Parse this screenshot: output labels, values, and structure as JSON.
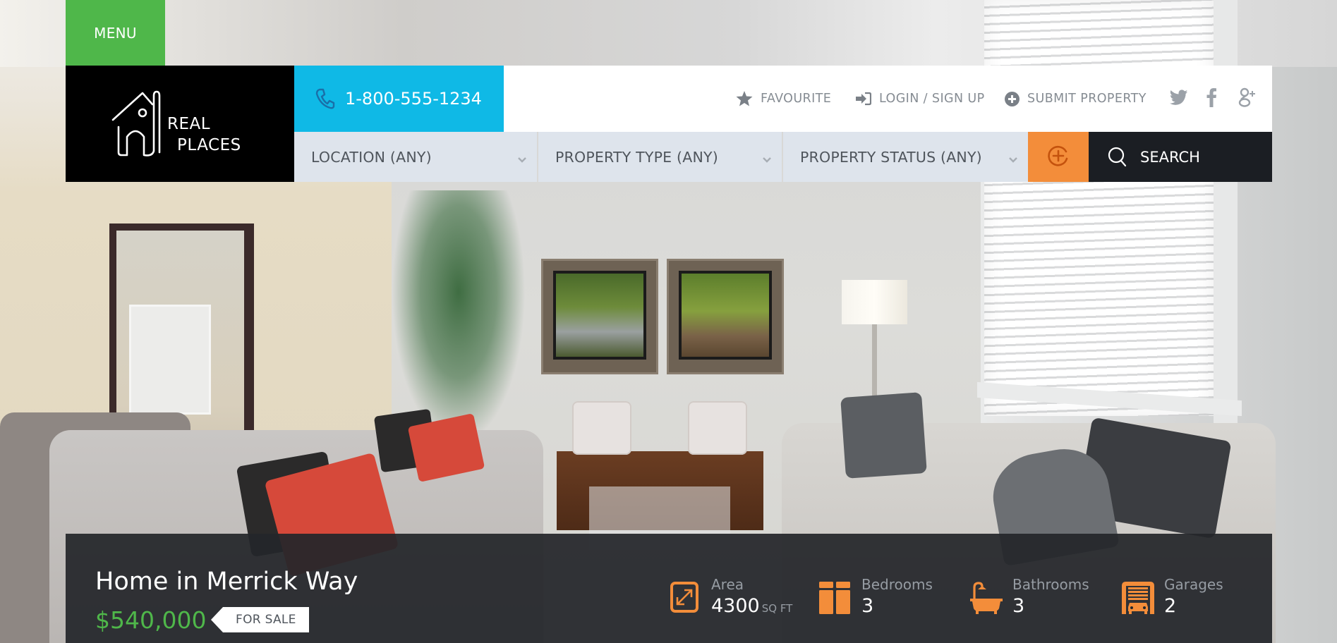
{
  "header": {
    "menu_label": "MENU",
    "logo": {
      "line1": "REAL",
      "line2": "PLACES",
      "icon": "house-logo-icon"
    },
    "phone": {
      "number": "1-800-555-1234",
      "icon": "phone-icon"
    },
    "links": [
      {
        "label": "FAVOURITE",
        "icon": "star-icon"
      },
      {
        "label": "LOGIN / SIGN UP",
        "icon": "sign-in-icon"
      },
      {
        "label": "SUBMIT PROPERTY",
        "icon": "plus-circle-icon"
      }
    ],
    "social": [
      {
        "name": "twitter",
        "icon": "twitter-icon"
      },
      {
        "name": "facebook",
        "icon": "facebook-icon"
      },
      {
        "name": "google-plus",
        "icon": "google-plus-icon"
      }
    ]
  },
  "search": {
    "location": "LOCATION (ANY)",
    "property_type": "PROPERTY TYPE (ANY)",
    "property_status": "PROPERTY STATUS (ANY)",
    "advanced_icon": "plus-circle-icon",
    "button_label": "SEARCH"
  },
  "property": {
    "title": "Home in Merrick Way",
    "price": "$540,000",
    "status": "FOR SALE",
    "stats": {
      "area": {
        "label": "Area",
        "value": "4300",
        "unit": "SQ FT"
      },
      "bedrooms": {
        "label": "Bedrooms",
        "value": "3"
      },
      "bathrooms": {
        "label": "Bathrooms",
        "value": "3"
      },
      "garages": {
        "label": "Garages",
        "value": "2"
      }
    }
  },
  "colors": {
    "menu_green": "#4fb74a",
    "phone_blue": "#0fb9e6",
    "accent_orange": "#f38d3a",
    "search_dark": "#1b1e23",
    "field_bg": "#dee4ec",
    "price_green": "#4fb74a"
  }
}
